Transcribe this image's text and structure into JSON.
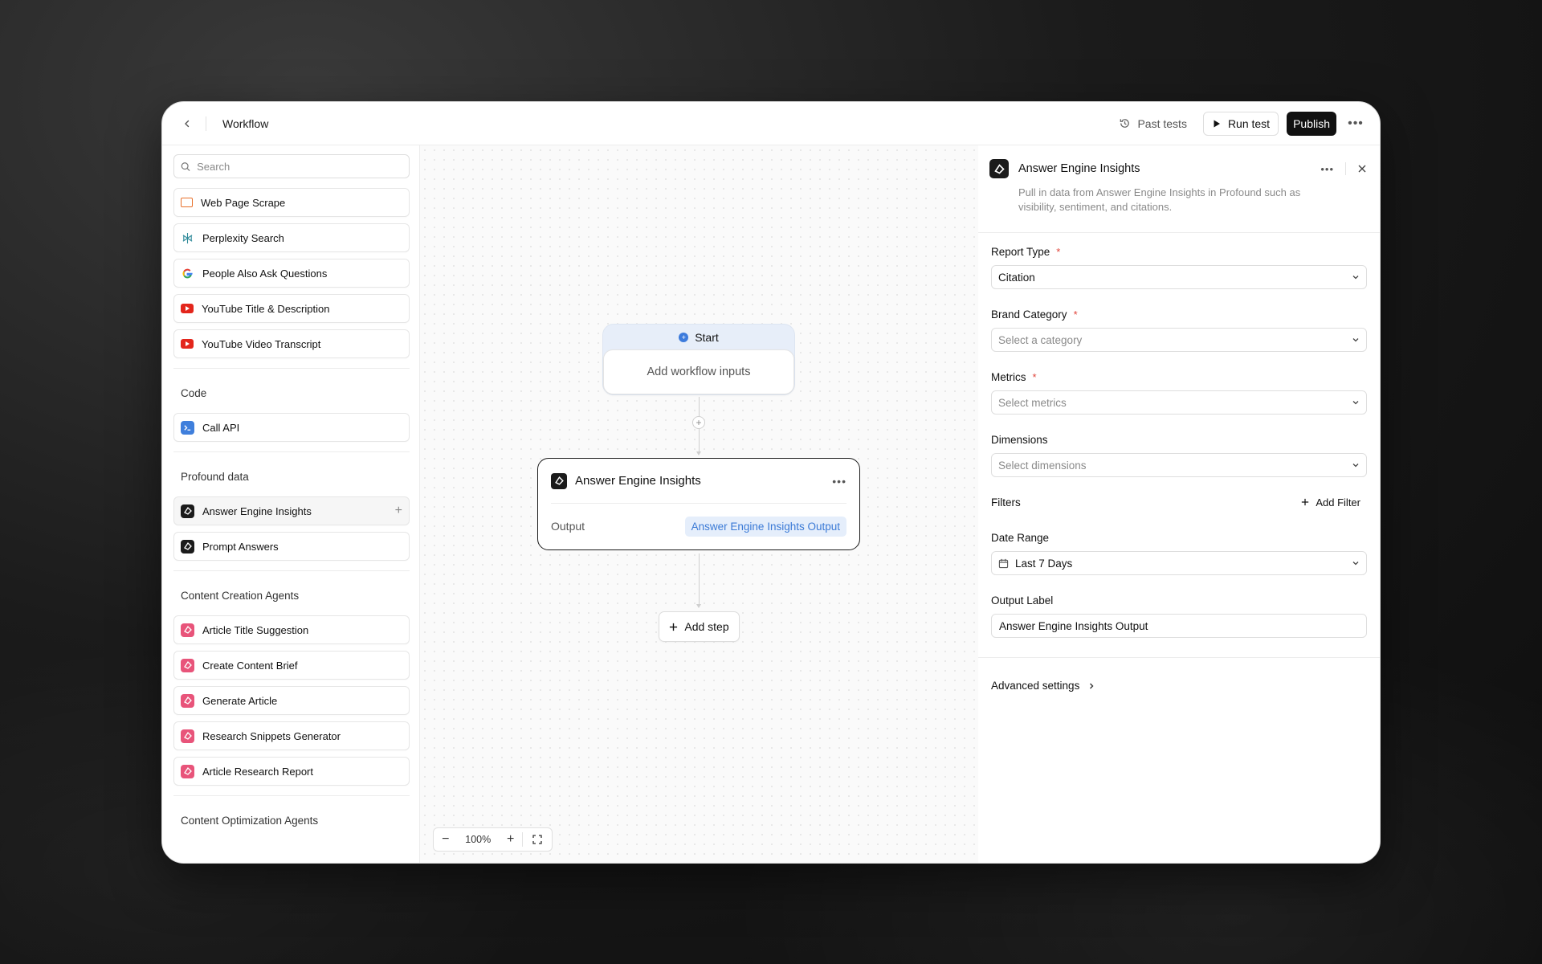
{
  "header": {
    "title": "Workflow",
    "past_tests": "Past tests",
    "run_test": "Run test",
    "publish": "Publish"
  },
  "sidebar": {
    "search_placeholder": "Search",
    "top_items": [
      {
        "label": "Web Page Scrape",
        "icon": "monitor-icon"
      },
      {
        "label": "Perplexity Search",
        "icon": "perplexity-icon"
      },
      {
        "label": "People Also Ask Questions",
        "icon": "google-icon"
      },
      {
        "label": "YouTube Title & Description",
        "icon": "youtube-icon"
      },
      {
        "label": "YouTube Video Transcript",
        "icon": "youtube-icon"
      }
    ],
    "groups": [
      {
        "label": "Code",
        "items": [
          {
            "label": "Call API",
            "icon": "terminal-icon"
          }
        ]
      },
      {
        "label": "Profound data",
        "items": [
          {
            "label": "Answer Engine Insights",
            "icon": "profound-icon"
          },
          {
            "label": "Prompt Answers",
            "icon": "profound-icon"
          }
        ]
      },
      {
        "label": "Content Creation Agents",
        "items": [
          {
            "label": "Article Title Suggestion",
            "icon": "agent-icon"
          },
          {
            "label": "Create Content Brief",
            "icon": "agent-icon"
          },
          {
            "label": "Generate Article",
            "icon": "agent-icon"
          },
          {
            "label": "Research Snippets Generator",
            "icon": "agent-icon"
          },
          {
            "label": "Article Research Report",
            "icon": "agent-icon"
          }
        ]
      },
      {
        "label": "Content Optimization Agents",
        "items": []
      }
    ]
  },
  "canvas": {
    "start_label": "Start",
    "start_body": "Add workflow inputs",
    "step_title": "Answer Engine Insights",
    "output_label": "Output",
    "output_value": "Answer Engine Insights Output",
    "add_step": "Add step",
    "zoom": "100%"
  },
  "panel": {
    "title": "Answer Engine Insights",
    "description": "Pull in data from Answer Engine Insights in Profound such as visibility, sentiment, and citations.",
    "report_type_label": "Report Type",
    "report_type_value": "Citation",
    "brand_category_label": "Brand Category",
    "brand_category_placeholder": "Select a category",
    "metrics_label": "Metrics",
    "metrics_placeholder": "Select metrics",
    "dimensions_label": "Dimensions",
    "dimensions_placeholder": "Select dimensions",
    "filters_label": "Filters",
    "add_filter": "Add Filter",
    "date_range_label": "Date Range",
    "date_range_value": "Last 7 Days",
    "output_label_label": "Output Label",
    "output_label_value": "Answer Engine Insights Output",
    "advanced_settings": "Advanced settings",
    "required_mark": "*"
  }
}
